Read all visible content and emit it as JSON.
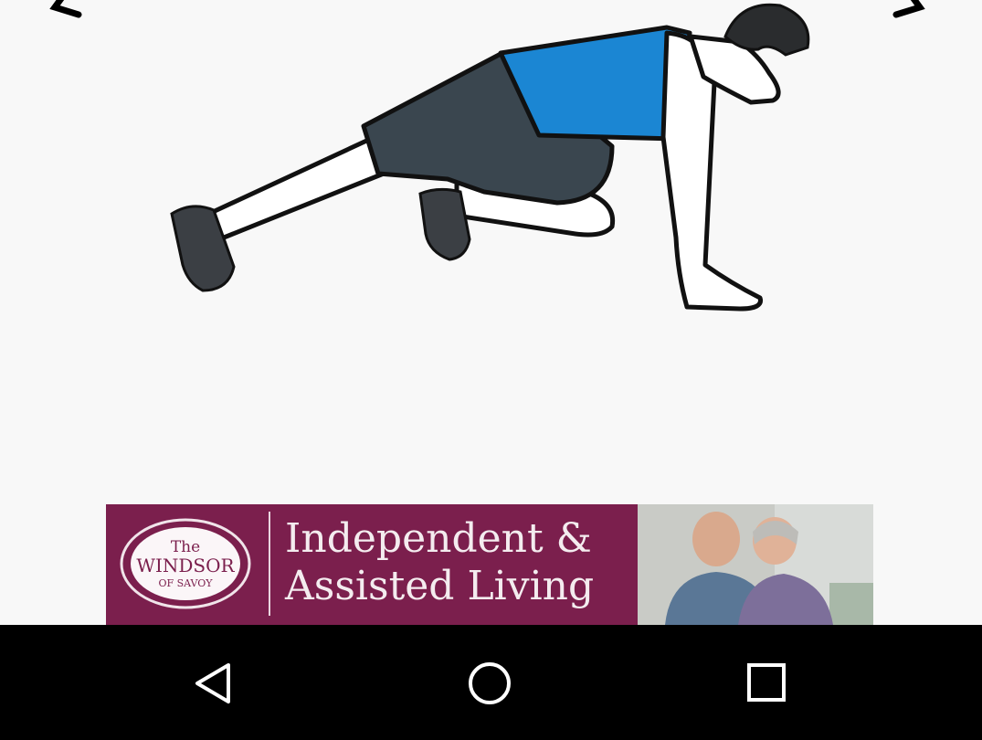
{
  "exercise": {
    "illustration": "mountain-climber-exercise"
  },
  "nav_arrows": {
    "prev_icon": "chevron-left-icon",
    "next_icon": "chevron-right-icon"
  },
  "ad": {
    "logo_line1": "The",
    "logo_line2": "WINDSOR",
    "logo_line3": "OF SAVOY",
    "headline_line1": "Independent &",
    "headline_line2": "Assisted Living",
    "background_color": "#7b1f4d"
  },
  "system_nav": {
    "back_icon": "back-triangle-icon",
    "home_icon": "home-circle-icon",
    "recents_icon": "recents-square-icon"
  }
}
